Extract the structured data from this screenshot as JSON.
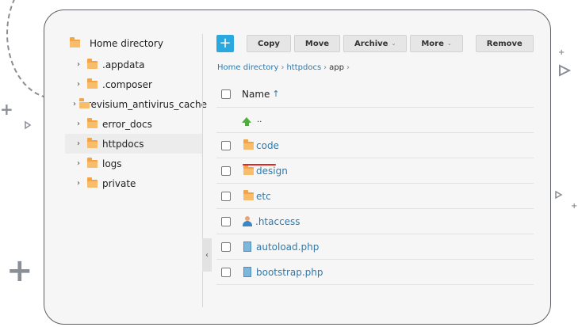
{
  "sidebar": {
    "root_label": "Home directory",
    "items": [
      {
        "label": ".appdata",
        "active": false
      },
      {
        "label": ".composer",
        "active": false
      },
      {
        "label": ".revisium_antivirus_cache",
        "active": false
      },
      {
        "label": "error_docs",
        "active": false
      },
      {
        "label": "httpdocs",
        "active": true
      },
      {
        "label": "logs",
        "active": false
      },
      {
        "label": "private",
        "active": false
      }
    ]
  },
  "toolbar": {
    "add_label": "+",
    "copy_label": "Copy",
    "move_label": "Move",
    "archive_label": "Archive",
    "more_label": "More",
    "remove_label": "Remove"
  },
  "breadcrumb": {
    "items": [
      "Home directory",
      "httpdocs",
      "app"
    ]
  },
  "table": {
    "name_header": "Name",
    "sort_indicator": "↑",
    "parent_label": "..",
    "rows": [
      {
        "name": "code",
        "type": "folder"
      },
      {
        "name": "design",
        "type": "folder"
      },
      {
        "name": "etc",
        "type": "folder"
      },
      {
        "name": ".htaccess",
        "type": "user-file"
      },
      {
        "name": "autoload.php",
        "type": "file"
      },
      {
        "name": "bootstrap.php",
        "type": "file"
      }
    ]
  },
  "colors": {
    "accent": "#2aa8e0",
    "link": "#2a7ab0",
    "folder": "#f3a447",
    "highlight_underline": "#e32222"
  }
}
